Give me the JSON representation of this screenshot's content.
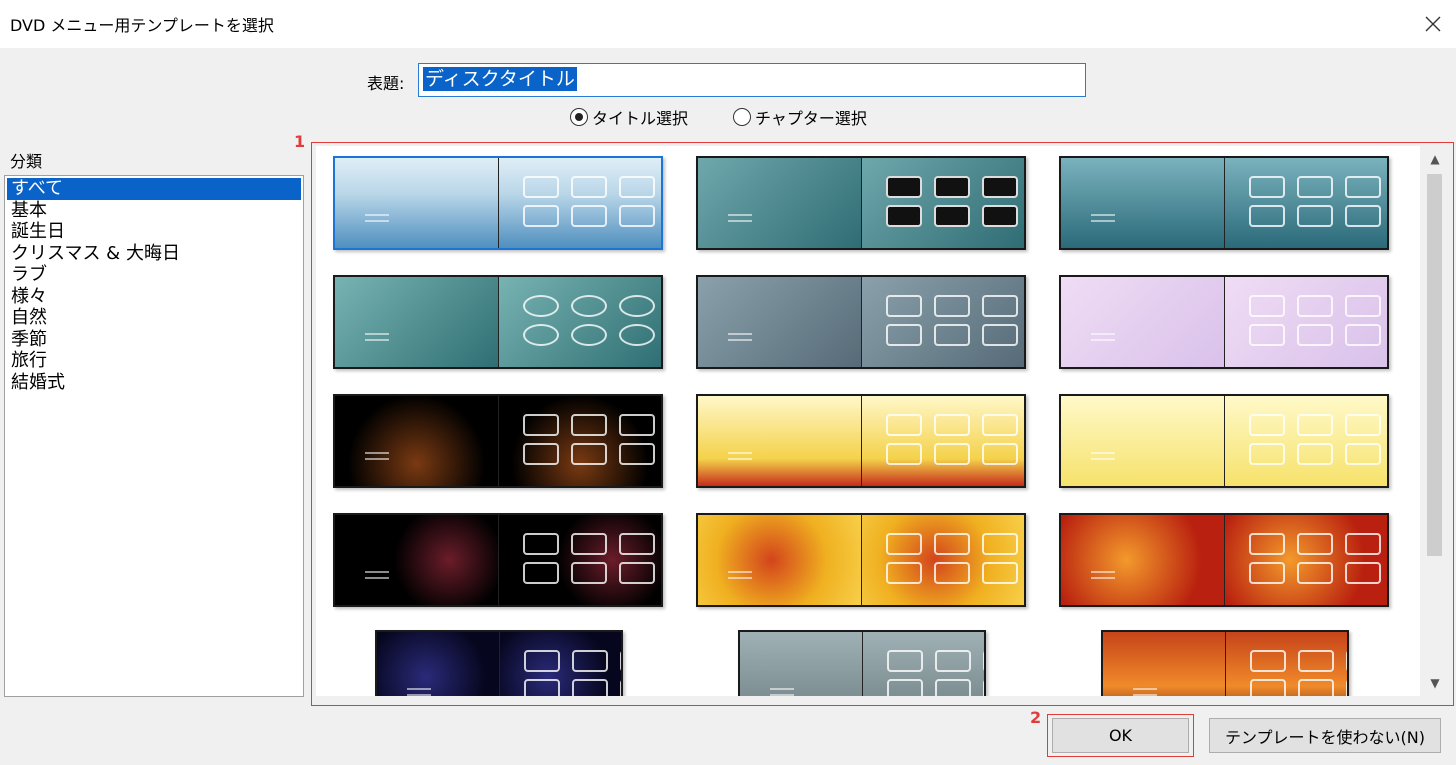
{
  "window": {
    "title": "DVD メニュー用テンプレートを選択"
  },
  "caption": {
    "label": "表題:",
    "value": "ディスクタイトル"
  },
  "mode": {
    "title_select": "タイトル選択",
    "chapter_select": "チャプター選択",
    "selected": "title_select"
  },
  "category": {
    "label": "分類",
    "items": [
      "すべて",
      "基本",
      "誕生日",
      "クリスマス & 大晦日",
      "ラブ",
      "様々",
      "自然",
      "季節",
      "旅行",
      "結婚式"
    ],
    "selected_index": 0
  },
  "annotations": {
    "grid_number": "1",
    "ok_number": "2"
  },
  "buttons": {
    "ok": "OK",
    "no_template": "テンプレートを使わない(N)"
  },
  "templates": [
    {
      "theme": "blue-wave",
      "selected": true
    },
    {
      "theme": "teal-dark-boxes"
    },
    {
      "theme": "teal-stripes"
    },
    {
      "theme": "teal-ovals"
    },
    {
      "theme": "gray-slate"
    },
    {
      "theme": "lilac-balloons"
    },
    {
      "theme": "birthday-cake"
    },
    {
      "theme": "christmas-yellow"
    },
    {
      "theme": "christmas-tree"
    },
    {
      "theme": "fireworks"
    },
    {
      "theme": "gold-heart"
    },
    {
      "theme": "red-hearts"
    },
    {
      "theme": "dark-swirl"
    },
    {
      "theme": "gray-paper"
    },
    {
      "theme": "orange-sunset"
    }
  ],
  "colors": {
    "accent": "#0a63c9",
    "annotation": "#e23b3b"
  }
}
